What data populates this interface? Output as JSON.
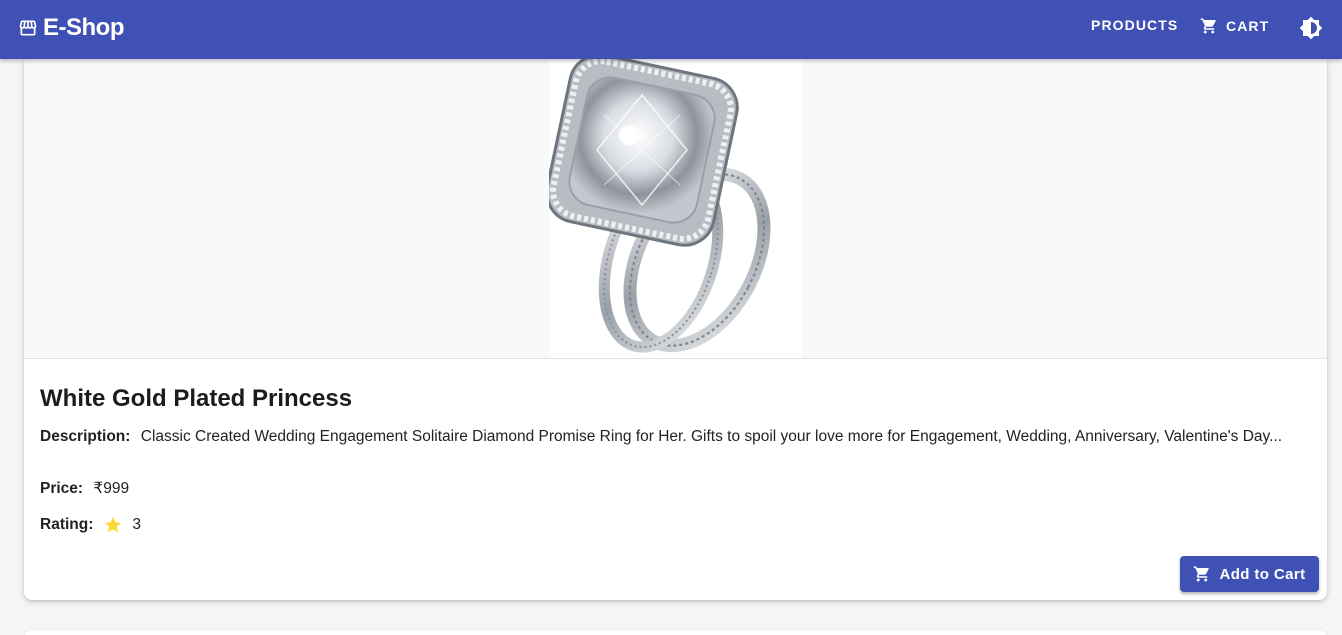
{
  "appbar": {
    "brand": "E-Shop",
    "brand_icon": "storefront-icon",
    "products_label": "PRODUCTS",
    "cart_label": "CART",
    "cart_icon": "cart-icon",
    "theme_icon": "brightness-toggle-icon",
    "color": "#3f51b5"
  },
  "product": {
    "title": "White Gold Plated Princess",
    "description_label": "Description:",
    "description": "Classic Created Wedding Engagement Solitaire Diamond Promise Ring for Her. Gifts to spoil your love more for Engagement, Wedding, Anniversary, Valentine's Day...",
    "price_label": "Price:",
    "price": "₹999",
    "rating_label": "Rating:",
    "rating": "3",
    "rating_icon": "star-icon",
    "star_color": "#fdd835",
    "add_to_cart_label": "Add to Cart"
  }
}
